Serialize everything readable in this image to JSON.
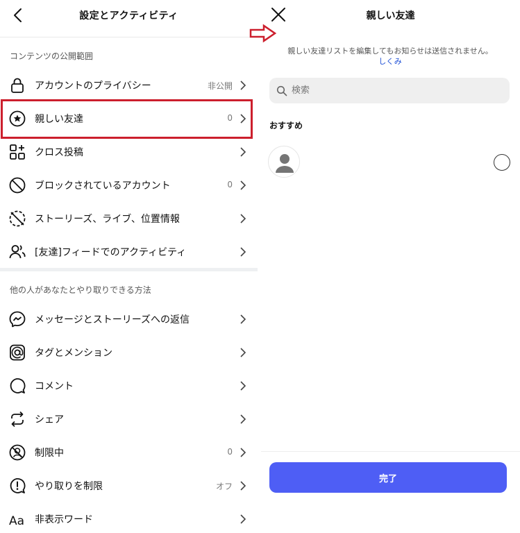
{
  "left": {
    "title": "設定とアクティビティ",
    "sections": [
      {
        "header": "コンテンツの公開範囲",
        "items": [
          {
            "label": "アカウントのプライバシー",
            "value": "非公開",
            "icon": "lock-icon"
          },
          {
            "label": "親しい友達",
            "value": "0",
            "icon": "star-circle-icon"
          },
          {
            "label": "クロス投稿",
            "value": "",
            "icon": "cross-post-icon"
          },
          {
            "label": "ブロックされているアカウント",
            "value": "0",
            "icon": "block-icon"
          },
          {
            "label": "ストーリーズ、ライブ、位置情報",
            "value": "",
            "icon": "story-hide-icon"
          },
          {
            "label": "[友達]フィードでのアクティビティ",
            "value": "",
            "icon": "friends-icon"
          }
        ]
      },
      {
        "header": "他の人があなたとやり取りできる方法",
        "items": [
          {
            "label": "メッセージとストーリーズへの返信",
            "value": "",
            "icon": "messenger-icon"
          },
          {
            "label": "タグとメンション",
            "value": "",
            "icon": "at-sign-icon"
          },
          {
            "label": "コメント",
            "value": "",
            "icon": "comment-icon"
          },
          {
            "label": "シェア",
            "value": "",
            "icon": "share-icon"
          },
          {
            "label": "制限中",
            "value": "0",
            "icon": "restrict-icon"
          },
          {
            "label": "やり取りを制限",
            "value": "オフ",
            "icon": "limit-icon"
          },
          {
            "label": "非表示ワード",
            "value": "",
            "icon": "hidden-words-icon"
          }
        ]
      }
    ]
  },
  "right": {
    "title": "親しい友達",
    "notice": "親しい友達リストを編集してもお知らせは送信されません。",
    "notice_link": "しくみ",
    "search": {
      "placeholder": "検索",
      "value": ""
    },
    "suggest_header": "おすすめ",
    "done_label": "完了"
  },
  "colors": {
    "accent": "#4e5ef5",
    "highlight": "#cc1f2d",
    "link": "#1d4fd6"
  }
}
